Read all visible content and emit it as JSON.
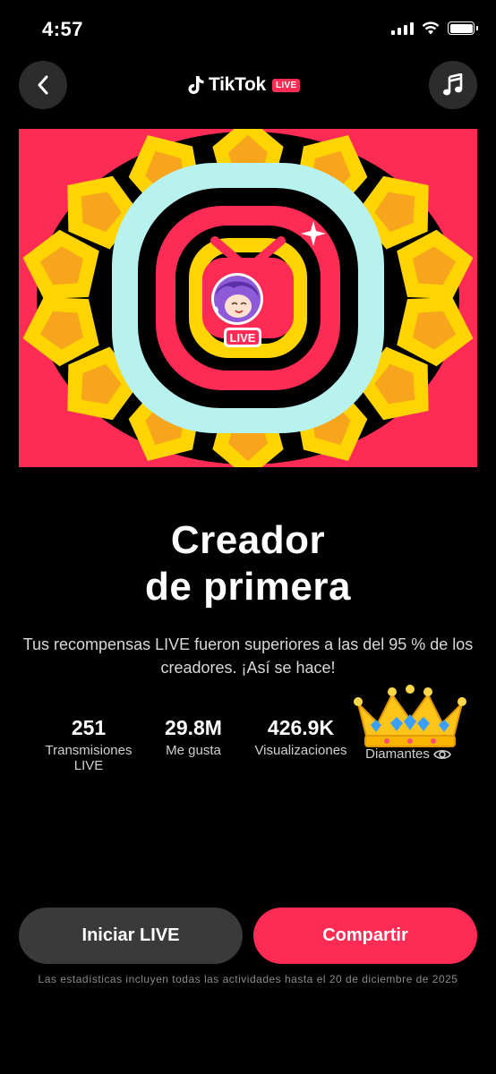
{
  "status_bar": {
    "time": "4:57"
  },
  "header": {
    "logo_text": "TikTok",
    "live_tag": "LIVE"
  },
  "hero": {
    "badge_text": "LIVE"
  },
  "main": {
    "title_line1": "Creador",
    "title_line2": "de primera",
    "subtitle": "Tus recompensas LIVE fueron superiores a las del 95 % de los creadores. ¡Así se hace!"
  },
  "stats": [
    {
      "value": "251",
      "label": "Transmisiones LIVE"
    },
    {
      "value": "29.8M",
      "label": "Me gusta"
    },
    {
      "value": "426.9K",
      "label": "Visualizaciones"
    }
  ],
  "diamonds": {
    "label": "Diamantes",
    "icon": "eye-icon"
  },
  "actions": {
    "start_live": "Iniciar LIVE",
    "share": "Compartir"
  },
  "footnote": "Las estadísticas incluyen todas las actividades hasta el 20 de diciembre de 2025",
  "colors": {
    "accent": "#fe2c55",
    "cyan": "#25f4ee",
    "ring_cyan": "#b7f2ee",
    "yellow": "#ffd400",
    "orange": "#f7a51c",
    "background": "#000000"
  }
}
